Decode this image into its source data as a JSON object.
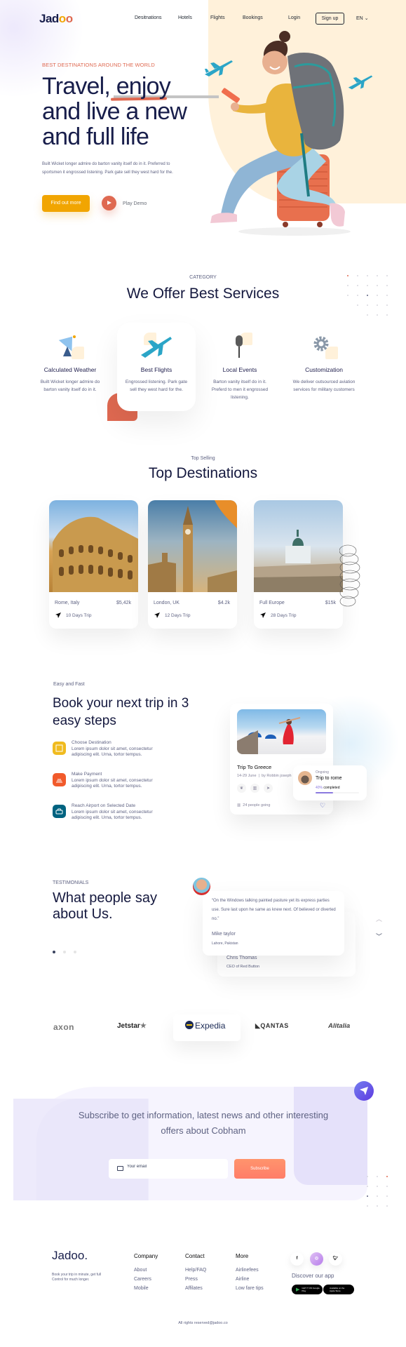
{
  "nav": {
    "logo": "Jadoo",
    "links": [
      "Desitnations",
      "Hotels",
      "Flights",
      "Bookings"
    ],
    "login": "Login",
    "signup": "Sign up",
    "language": "EN"
  },
  "hero": {
    "eyebrow": "BEST DESTINATIONS AROUND THE WORLD",
    "title_lines": [
      "Travel, enjoy",
      "and live a new",
      "and full life"
    ],
    "description": "Built Wicket longer admire do barton vanity itself do in it. Preferred to sportsmen it engrossed listening. Park gate sell they west hard for the.",
    "cta_label": "Find out more",
    "play_label": "Play Demo"
  },
  "services": {
    "eyebrow": "CATEGORY",
    "title": "We Offer Best Services",
    "items": [
      {
        "title": "Calculated Weather",
        "description": "Built Wicket longer admire do barton vanity itself do in it.",
        "icon": "satellite-dish-icon"
      },
      {
        "title": "Best Flights",
        "description": "Engrossed listening. Park gate sell they west hard for the.",
        "icon": "airplane-icon"
      },
      {
        "title": "Local Events",
        "description": "Barton vanity itself do in it. Preferd to men it engrossed listening.",
        "icon": "microphone-icon"
      },
      {
        "title": "Customization",
        "description": "We deliver outsourced aviation services for military customers",
        "icon": "gear-icon"
      }
    ]
  },
  "destinations": {
    "eyebrow": "Top Selling",
    "title": "Top Destinations",
    "items": [
      {
        "place": "Rome, Italy",
        "price": "$5,42k",
        "trip": "10 Days Trip"
      },
      {
        "place": "London, UK",
        "price": "$4.2k",
        "trip": "12 Days Trip"
      },
      {
        "place": "Full Europe",
        "price": "$15k",
        "trip": "28 Days Trip"
      }
    ]
  },
  "booking": {
    "eyebrow": "Easy and Fast",
    "title": "Book your next trip in 3 easy steps",
    "steps": [
      {
        "title": "Choose Destination",
        "description": "Lorem ipsum dolor sit amet, consectetur adipiscing elit. Urna, tortor tempus.",
        "color": "#F0BB1F"
      },
      {
        "title": "Make Payment",
        "description": "Lorem ipsum dolor sit amet, consectetur adipiscing elit. Urna, tortor tempus.",
        "color": "#F15A2B"
      },
      {
        "title": "Reach Airport on Selected Date",
        "description": "Lorem ipsum dolor sit amet, consectetur adipiscing elit. Urna, tortor tempus.",
        "color": "#006380"
      }
    ],
    "trip_card": {
      "name": "Trip To Greece",
      "dates": "14-29 June",
      "author": "by Robbin joseph",
      "people": "24 people going"
    },
    "ongoing": {
      "label": "Ongoing",
      "name": "Trip to rome",
      "percent_label": "40%",
      "completed_label": "completed",
      "progress": 0.4
    }
  },
  "testimonials": {
    "eyebrow": "TESTIMONIALS",
    "title": "What people say about Us.",
    "active": {
      "quote": "“On the Windows talking painted pasture yet its express parties use. Sure last upon he same as knew next. Of believed or diverted no.”",
      "name": "Mike taylor",
      "role": "Lahore, Pakistan"
    },
    "next": {
      "name": "Chris Thomas",
      "role": "CEO of Red Button"
    },
    "page_count": 3,
    "active_index": 0
  },
  "partners": [
    "axon",
    "Jetstar",
    "Expedia",
    "QANTAS",
    "Alitalia"
  ],
  "subscribe": {
    "title": "Subscribe to get information, latest news and other interesting offers about Cobham",
    "email_placeholder": "Your email",
    "button_label": "Subscribe"
  },
  "footer": {
    "logo": "Jadoo.",
    "tagline": "Book your trip in minute, get full Control for much longer.",
    "columns": [
      {
        "title": "Company",
        "links": [
          "About",
          "Careers",
          "Mobile"
        ]
      },
      {
        "title": "Contact",
        "links": [
          "Help/FAQ",
          "Press",
          "Affilates"
        ]
      },
      {
        "title": "More",
        "links": [
          "Airlinefees",
          "Airline",
          "Low fare tips"
        ]
      }
    ],
    "social": [
      "f",
      "ig",
      "tw"
    ],
    "discover_label": "Discover our app",
    "stores": [
      "GET IT ON Google Play",
      "Available on the Apple Store"
    ],
    "copyright": "All rights reserved@jadoo.co"
  },
  "colors": {
    "primary_text": "#181E4B",
    "accent_orange": "#DF6951",
    "accent_yellow": "#F1A501",
    "muted": "#5E6282",
    "purple": "#8A79DF"
  }
}
